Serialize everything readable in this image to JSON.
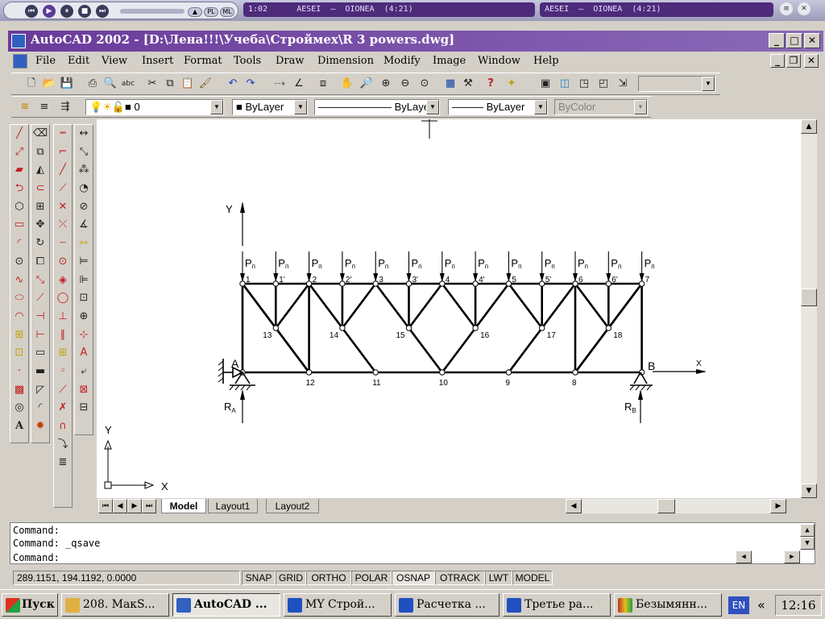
{
  "winamp": {
    "time": "1:02",
    "track": "AESEI  –  OIONEA  (4:21)",
    "track2": "AESEI  –  OIONEA  (4:21)",
    "pl_label": "PL",
    "ml_label": "ML"
  },
  "titlebar": {
    "title": "AutoCAD 2002 - [D:\\Лена!!!\\Учеба\\Строймех\\R 3 powers.dwg]",
    "minimize": "_",
    "maximize": "□",
    "close": "✕"
  },
  "menu": [
    "File",
    "Edit",
    "View",
    "Insert",
    "Format",
    "Tools",
    "Draw",
    "Dimension",
    "Modify",
    "Image",
    "Window",
    "Help"
  ],
  "layers": {
    "layer_value": "0",
    "color_value": "ByLayer",
    "linetype_value": "ByLayer",
    "lineweight_value": "ByLayer",
    "plotstyle_value": "ByColor"
  },
  "drawing": {
    "y_axis": "Y",
    "x_axis": "X",
    "ucs_x": "X",
    "ucs_y": "Y",
    "load_label": "P",
    "load_sub": "п",
    "support_a": "A",
    "support_b": "B",
    "reaction_a": "R",
    "reaction_a_sub": "A",
    "reaction_b": "R",
    "reaction_b_sub": "B",
    "top_nodes": [
      "1",
      "1'",
      "2",
      "2'",
      "3",
      "3'",
      "4",
      "4'",
      "5",
      "5'",
      "6",
      "6'",
      "7"
    ],
    "bottom_nodes": [
      "12",
      "11",
      "10",
      "9",
      "8"
    ],
    "mid_nodes": [
      "13",
      "14",
      "15",
      "16",
      "17",
      "18"
    ]
  },
  "tabs": [
    "Model",
    "Layout1",
    "Layout2"
  ],
  "command": {
    "line1": "Command:",
    "line2": "Command: _qsave",
    "line3": "Command:"
  },
  "status": {
    "coords": "289.1151, 194.1192, 0.0000",
    "buttons": [
      "SNAP",
      "GRID",
      "ORTHO",
      "POLAR",
      "OSNAP",
      "OTRACK",
      "LWT",
      "MODEL"
    ]
  },
  "taskbar": {
    "start": "Пуск",
    "tasks": [
      "208. МакS...",
      "AutoCAD ...",
      "MY Строй...",
      "Расчетка ...",
      "Третье ра...",
      "Безымянн..."
    ],
    "lang": "EN",
    "arrows": "«",
    "clock": "12:16"
  }
}
